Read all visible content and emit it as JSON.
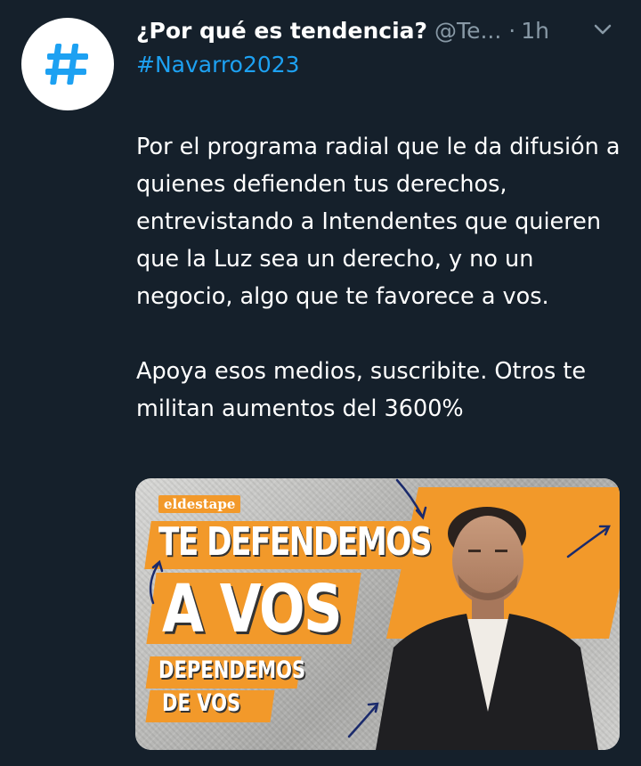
{
  "tweet": {
    "avatar_icon": "hashtag-icon",
    "title": "¿Por qué es tendencia?",
    "handle": "@Te...",
    "separator": "·",
    "time": "1h",
    "menu_icon": "chevron-down-icon",
    "hashtag": "#Navarro2023",
    "paragraphs": [
      "Por el programa radial que le da difusión a quienes defienden tus derechos, entrevistando a Intendentes que quieren que la Luz sea un derecho, y no un negocio, algo que te favorece a vos.",
      "Apoya esos medios, suscribite. Otros te militan aumentos del 3600%"
    ]
  },
  "media": {
    "brand": "eldestape",
    "headline_1": "TE DEFENDEMOS",
    "headline_2": "A VOS",
    "subline_1": "DEPENDEMOS",
    "subline_2": "DE VOS",
    "colors": {
      "accent": "#f2992a",
      "text": "#ffffff",
      "jacket": "#1f1f22",
      "arrows": "#1a2a6c"
    }
  },
  "colors": {
    "background": "#15202b",
    "link": "#1da1f2",
    "muted": "#8899a6"
  }
}
